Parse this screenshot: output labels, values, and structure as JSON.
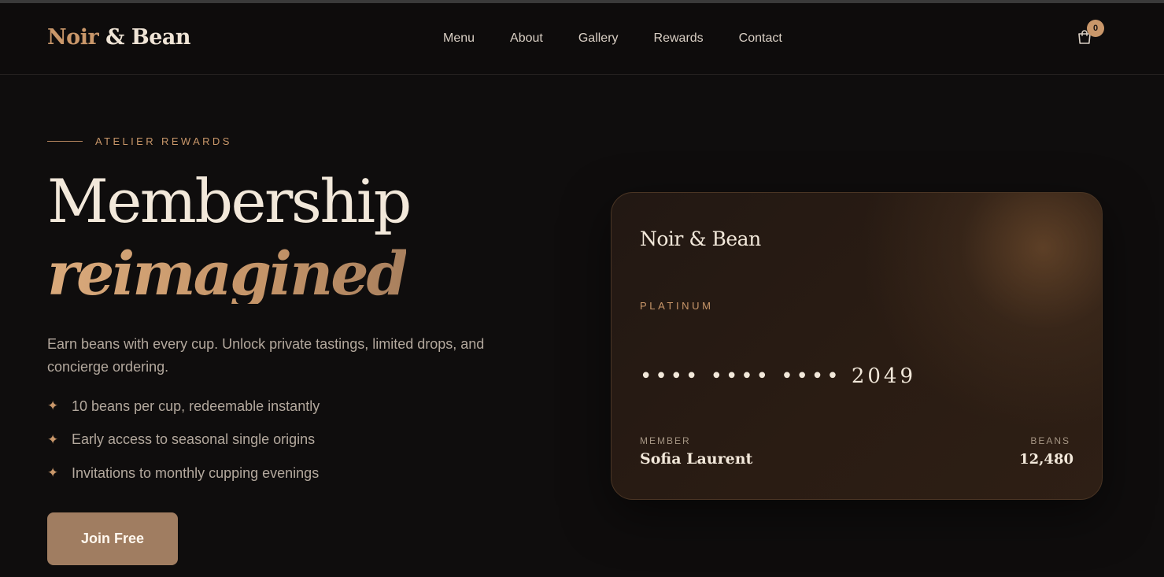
{
  "brand": {
    "word1": "Noir",
    "amp": "&",
    "word2": "Bean"
  },
  "nav": [
    {
      "label": "Menu"
    },
    {
      "label": "About"
    },
    {
      "label": "Gallery"
    },
    {
      "label": "Rewards"
    },
    {
      "label": "Contact"
    }
  ],
  "cart": {
    "icon": "shopping-bag-icon",
    "count": "0"
  },
  "hero": {
    "eyebrow": "ATELIER REWARDS",
    "title_line1": "Membership",
    "title_line2": "reimagined",
    "lede": "Earn beans with every cup. Unlock private tastings, limited drops, and concierge ordering.",
    "perks": [
      {
        "icon": "✦",
        "text": "10 beans per cup, redeemable instantly"
      },
      {
        "icon": "✦",
        "text": "Early access to seasonal single origins"
      },
      {
        "icon": "✦",
        "text": "Invitations to monthly cupping evenings"
      }
    ],
    "cta": "Join Free"
  },
  "card": {
    "brand": "Noir & Bean",
    "tier": "PLATINUM",
    "number": "•••• •••• •••• 2049",
    "member_label": "MEMBER",
    "member_name": "Sofia Laurent",
    "beans_label": "BEANS",
    "beans_value": "12,480"
  },
  "colors": {
    "accent": "#c9976a",
    "background": "#0f0d0d",
    "button": "#a07d61"
  }
}
